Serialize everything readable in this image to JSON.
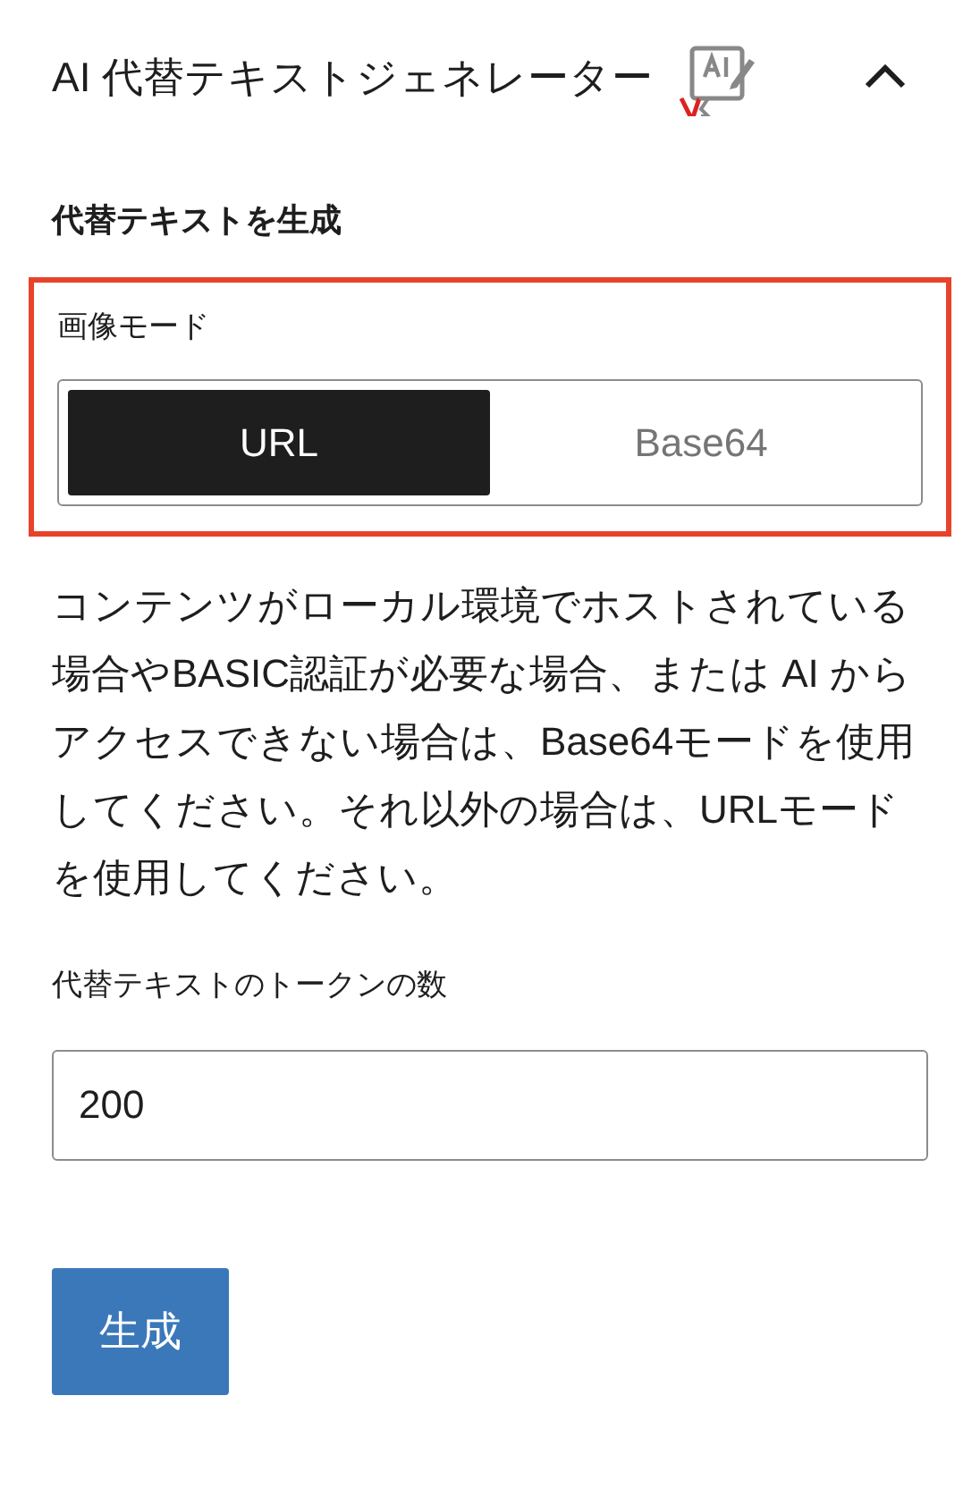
{
  "panel": {
    "title": "AI 代替テキストジェネレーター",
    "expanded": true
  },
  "section": {
    "heading": "代替テキストを生成",
    "image_mode": {
      "label": "画像モード",
      "highlighted": true,
      "options": [
        {
          "label": "URL",
          "selected": true
        },
        {
          "label": "Base64",
          "selected": false
        }
      ]
    },
    "help_text": "コンテンツがローカル環境でホストされている場合やBASIC認証が必要な場合、または AI からアクセスできない場合は、Base64モードを使用してください。それ以外の場合は、URLモードを使用してください。",
    "tokens": {
      "label": "代替テキストのトークンの数",
      "value": "200"
    },
    "button": "生成"
  }
}
